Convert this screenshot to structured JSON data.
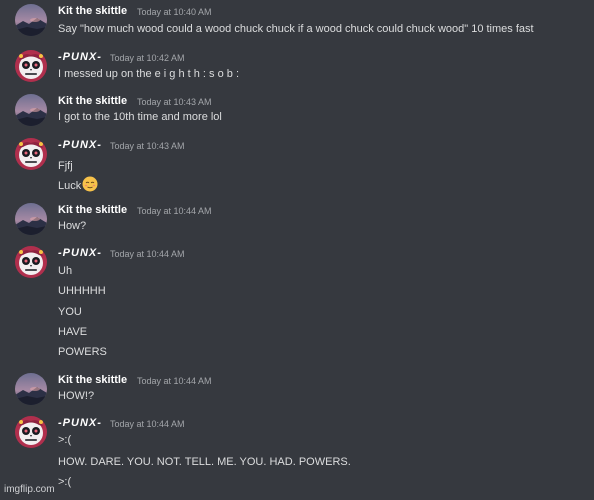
{
  "messages": [
    {
      "user": "Kit the skittle",
      "time": "Today at 10:40 AM",
      "lines": [
        "Say \"how much wood could a wood chuck chuck if a wood chuck could chuck wood\" 10 times fast"
      ]
    },
    {
      "user": "-PUNX-",
      "time": "Today at 10:42 AM",
      "lines": [
        "I messed up on the e i g h t h : s o b :"
      ]
    },
    {
      "user": "Kit the skittle",
      "time": "Today at 10:43 AM",
      "lines": [
        "I got to the 10th time and more lol"
      ]
    },
    {
      "user": "-PUNX-",
      "time": "Today at 10:43 AM",
      "lines": [
        "Fjfj",
        "Luck"
      ]
    },
    {
      "user": "Kit the skittle",
      "time": "Today at 10:44 AM",
      "lines": [
        "How?"
      ]
    },
    {
      "user": "-PUNX-",
      "time": "Today at 10:44 AM",
      "lines": [
        "Uh",
        "UHHHHH",
        "YOU",
        "HAVE",
        "POWERS"
      ]
    },
    {
      "user": "Kit the skittle",
      "time": "Today at 10:44 AM",
      "lines": [
        "HOW!?"
      ]
    },
    {
      "user": "-PUNX-",
      "time": "Today at 10:44 AM",
      "lines": [
        ">:(",
        "HOW. DARE. YOU. NOT. TELL. ME. YOU. HAD. POWERS.",
        ">:("
      ]
    }
  ],
  "watermark": "imgflip.com",
  "colors": {
    "background": "#36393f",
    "text": "#dcddde",
    "username": "#ffffff",
    "timestamp": "#a3a6aa"
  },
  "icons": {
    "kit_avatar": "sunset-landscape-avatar",
    "punx_avatar": "sugar-skull-avatar",
    "luck_emoji": "relieved-face-emoji"
  }
}
